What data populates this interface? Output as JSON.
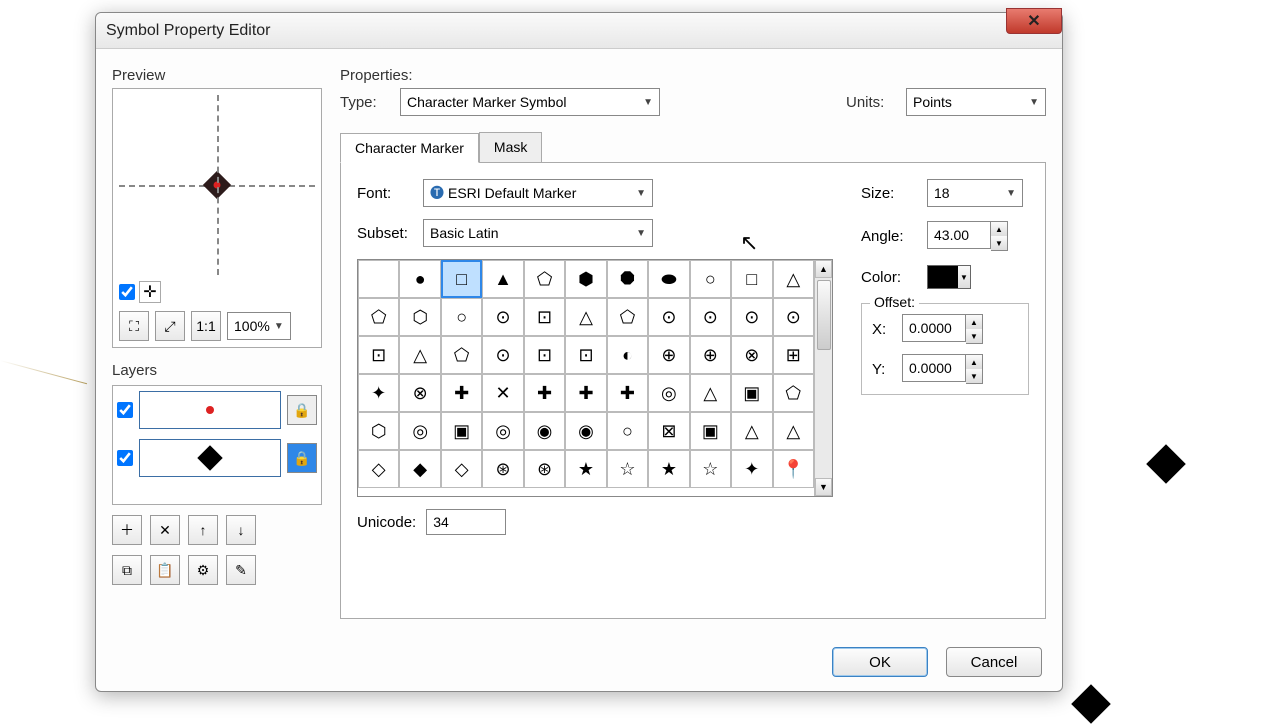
{
  "window": {
    "title": "Symbol Property Editor"
  },
  "preview": {
    "label": "Preview",
    "zoom": "100%"
  },
  "layers": {
    "label": "Layers"
  },
  "properties": {
    "label": "Properties:",
    "type_label": "Type:",
    "type_value": "Character Marker Symbol",
    "units_label": "Units:",
    "units_value": "Points"
  },
  "tabs": {
    "char": "Character Marker",
    "mask": "Mask"
  },
  "char_panel": {
    "font_label": "Font:",
    "font_value": "ESRI Default Marker",
    "subset_label": "Subset:",
    "subset_value": "Basic Latin",
    "unicode_label": "Unicode:",
    "unicode_value": "34",
    "size_label": "Size:",
    "size_value": "18",
    "angle_label": "Angle:",
    "angle_value": "43.00",
    "color_label": "Color:",
    "offset_label": "Offset:",
    "offset_x_label": "X:",
    "offset_x": "0.0000",
    "offset_y_label": "Y:",
    "offset_y": "0.0000"
  },
  "buttons": {
    "ok": "OK",
    "cancel": "Cancel"
  },
  "glyphs": [
    "",
    "●",
    "□",
    "▲",
    "⬠",
    "⬢",
    "⯃",
    "⬬",
    "○",
    "□",
    "△",
    "⬠",
    "⬡",
    "○",
    "⊙",
    "⊡",
    "△",
    "⬠",
    "⊙",
    "⊙",
    "⊙",
    "⊙",
    "⊡",
    "△",
    "⬠",
    "⊙",
    "⊡",
    "⊡",
    "◐",
    "⊕",
    "⊕",
    "⊗",
    "⊞",
    "✦",
    "⊗",
    "✚",
    "✕",
    "✚",
    "✚",
    "✚",
    "◎",
    "△",
    "▣",
    "⬠",
    "⬡",
    "◎",
    "▣",
    "◎",
    "◉",
    "◉",
    "○",
    "⊠",
    "▣",
    "△",
    "△",
    "◇",
    "◆",
    "◇",
    "⊛",
    "⊛",
    "★",
    "☆",
    "★",
    "☆",
    "✦",
    "📍"
  ],
  "selected_glyph": 2
}
